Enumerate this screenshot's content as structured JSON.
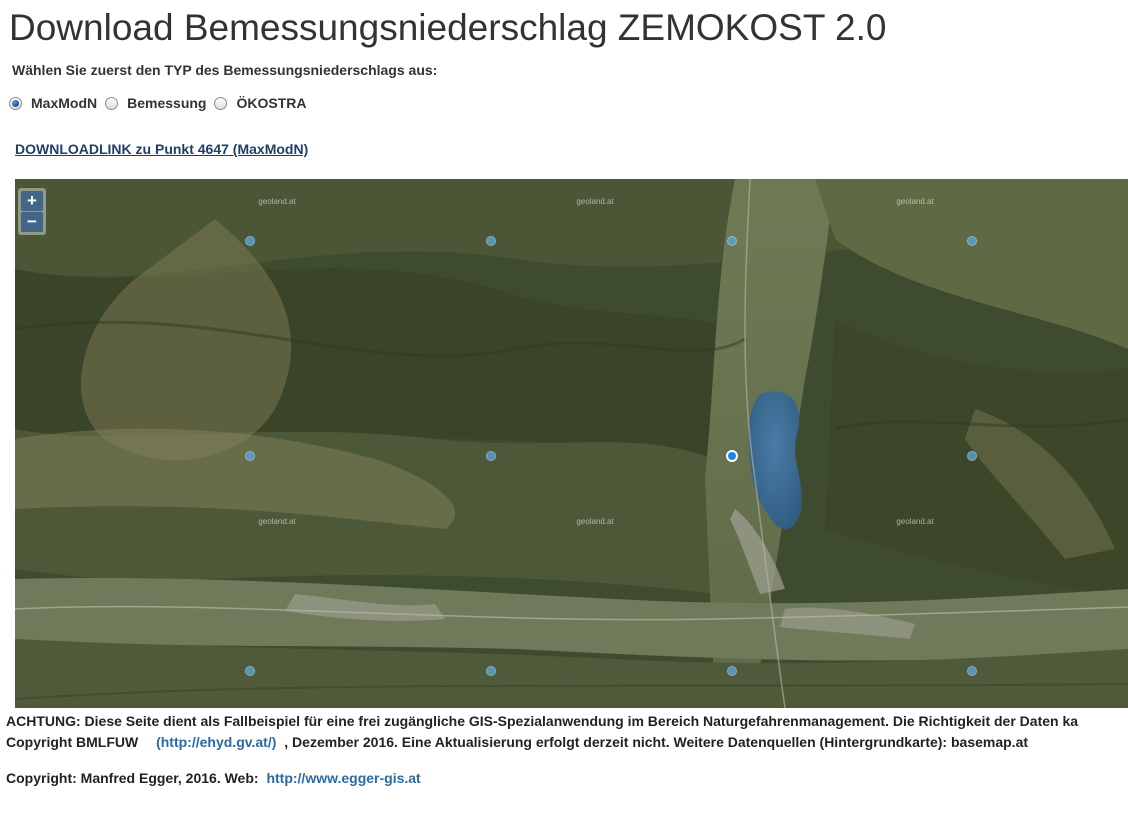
{
  "page": {
    "title": "Download Bemessungsniederschlag ZEMOKOST 2.0",
    "intro": "Wählen Sie zuerst den TYP des Bemessungsniederschlags aus:"
  },
  "type_options": [
    {
      "label": "MaxModN",
      "checked": true
    },
    {
      "label": "Bemessung",
      "checked": false
    },
    {
      "label": "ÖKOSTRA",
      "checked": false
    }
  ],
  "download_link": "DOWNLOADLINK zu Punkt 4647 (MaxModN)",
  "map": {
    "zoom_in": "+",
    "zoom_out": "−",
    "watermark": "geoland.at",
    "selected_point_color": "#1a84e8",
    "point_color": "#5aa8e0",
    "lake_color": "#3e6f9a"
  },
  "notice": {
    "line1": "ACHTUNG: Diese Seite dient als Fallbeispiel für eine frei zugängliche GIS-Spezialanwendung im Bereich Naturgefahrenmanagement. Die Richtigkeit der Daten ka",
    "line2_prefix": "Copyright BMLFUW",
    "line2_link": "(http://ehyd.gv.at/)",
    "line2_suffix": ", Dezember 2016. Eine Aktualisierung erfolgt derzeit nicht. Weitere Datenquellen (Hintergrundkarte): basemap.at"
  },
  "footer": {
    "text": "Copyright: Manfred Egger, 2016. Web:",
    "link": "http://www.egger-gis.at"
  }
}
